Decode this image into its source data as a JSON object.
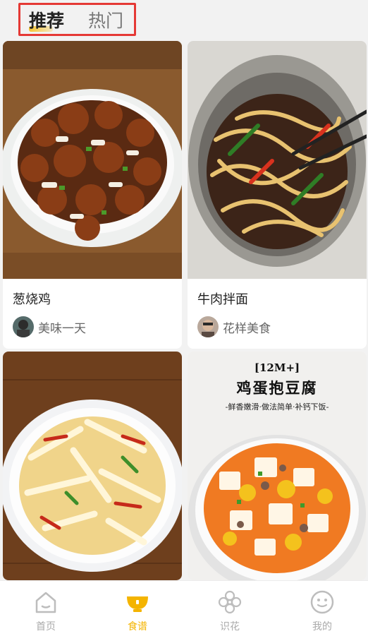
{
  "tabs": {
    "recommend": "推荐",
    "hot": "热门"
  },
  "cards": [
    {
      "title": "葱烧鸡",
      "author": "美味一天"
    },
    {
      "title": "牛肉拌面",
      "author": "花样美食"
    },
    {
      "title": "",
      "author": ""
    },
    {
      "title": "",
      "author": ""
    }
  ],
  "poster": {
    "tag": "[12M+]",
    "headline": "鸡蛋抱豆腐",
    "subline": "-鲜香嫩滑·做法简单·补钙下饭-"
  },
  "nav": [
    {
      "label": "首页",
      "icon": "home-icon"
    },
    {
      "label": "食谱",
      "icon": "recipe-bowl-icon"
    },
    {
      "label": "识花",
      "icon": "flower-icon"
    },
    {
      "label": "我的",
      "icon": "profile-face-icon"
    }
  ],
  "colors": {
    "accent": "#f4b400",
    "highlight_box": "#e53935"
  }
}
